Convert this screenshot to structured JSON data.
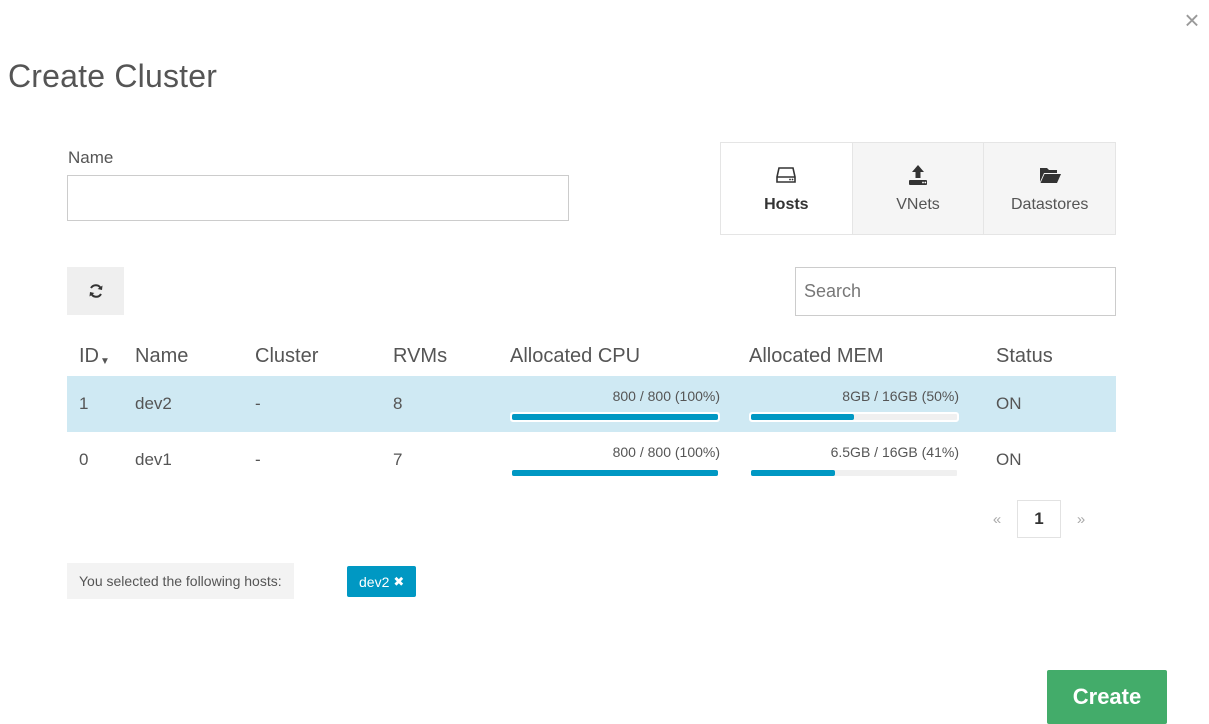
{
  "dialog": {
    "title": "Create Cluster",
    "close_symbol": "×"
  },
  "form": {
    "name_label": "Name",
    "name_value": "",
    "name_placeholder": ""
  },
  "tabs": [
    {
      "label": "Hosts",
      "icon": "server-icon",
      "active": true
    },
    {
      "label": "VNets",
      "icon": "upload-icon",
      "active": false
    },
    {
      "label": "Datastores",
      "icon": "folder-open-icon",
      "active": false
    }
  ],
  "toolbar": {
    "refresh_icon": "refresh-icon",
    "search_placeholder": "Search"
  },
  "table": {
    "columns": [
      "ID",
      "Name",
      "Cluster",
      "RVMs",
      "Allocated CPU",
      "Allocated MEM",
      "Status"
    ],
    "sort_indicator": "▼",
    "rows": [
      {
        "id": "1",
        "name": "dev2",
        "cluster": "-",
        "rvms": "8",
        "cpu_text": "800 / 800 (100%)",
        "cpu_pct": 100,
        "mem_text": "8GB / 16GB (50%)",
        "mem_pct": 50,
        "status": "ON",
        "selected": true
      },
      {
        "id": "0",
        "name": "dev1",
        "cluster": "-",
        "rvms": "7",
        "cpu_text": "800 / 800 (100%)",
        "cpu_pct": 100,
        "mem_text": "6.5GB / 16GB (41%)",
        "mem_pct": 41,
        "status": "ON",
        "selected": false
      }
    ]
  },
  "pagination": {
    "prev": "«",
    "current_page": "1",
    "next": "»"
  },
  "selection": {
    "label": "You selected the following hosts:",
    "tags": [
      {
        "label": "dev2",
        "remove_symbol": "✖"
      }
    ]
  },
  "actions": {
    "create_label": "Create"
  },
  "colors": {
    "accent": "#0098c3",
    "selected_row": "#cfe9f3",
    "create_button": "#43ac6a"
  }
}
